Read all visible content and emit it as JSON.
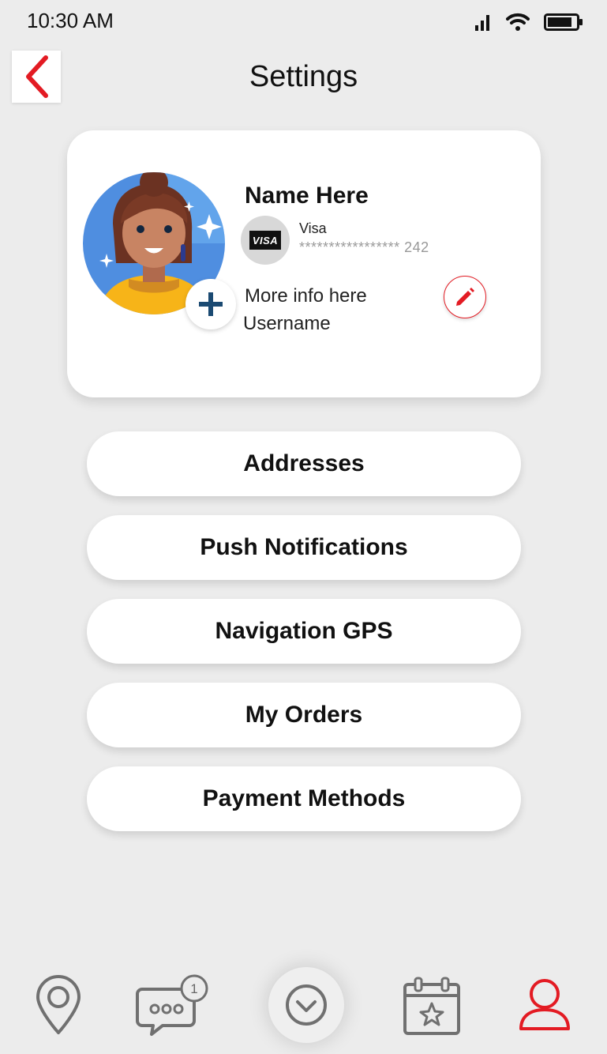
{
  "status_bar": {
    "time": "10:30 AM"
  },
  "header": {
    "title": "Settings"
  },
  "profile": {
    "name": "Name Here",
    "card_brand_logo": "VISA",
    "card_type": "Visa",
    "card_number": "***************** 242",
    "more_info": "More info here",
    "username": "Username"
  },
  "menu": {
    "items": [
      {
        "label": "Addresses"
      },
      {
        "label": "Push Notifications"
      },
      {
        "label": "Navigation GPS"
      },
      {
        "label": "My Orders"
      },
      {
        "label": "Payment Methods"
      }
    ]
  },
  "bottom_nav": {
    "items": [
      {
        "icon": "location-pin-icon"
      },
      {
        "icon": "chat-icon",
        "badge": "1"
      },
      {
        "icon": "chevron-down-circle-icon"
      },
      {
        "icon": "calendar-star-icon"
      },
      {
        "icon": "user-icon"
      }
    ],
    "active": "user-icon"
  },
  "colors": {
    "accent": "#e31b23",
    "background": "#ececec",
    "plus": "#1b4a72",
    "nav_icon": "#707070"
  }
}
